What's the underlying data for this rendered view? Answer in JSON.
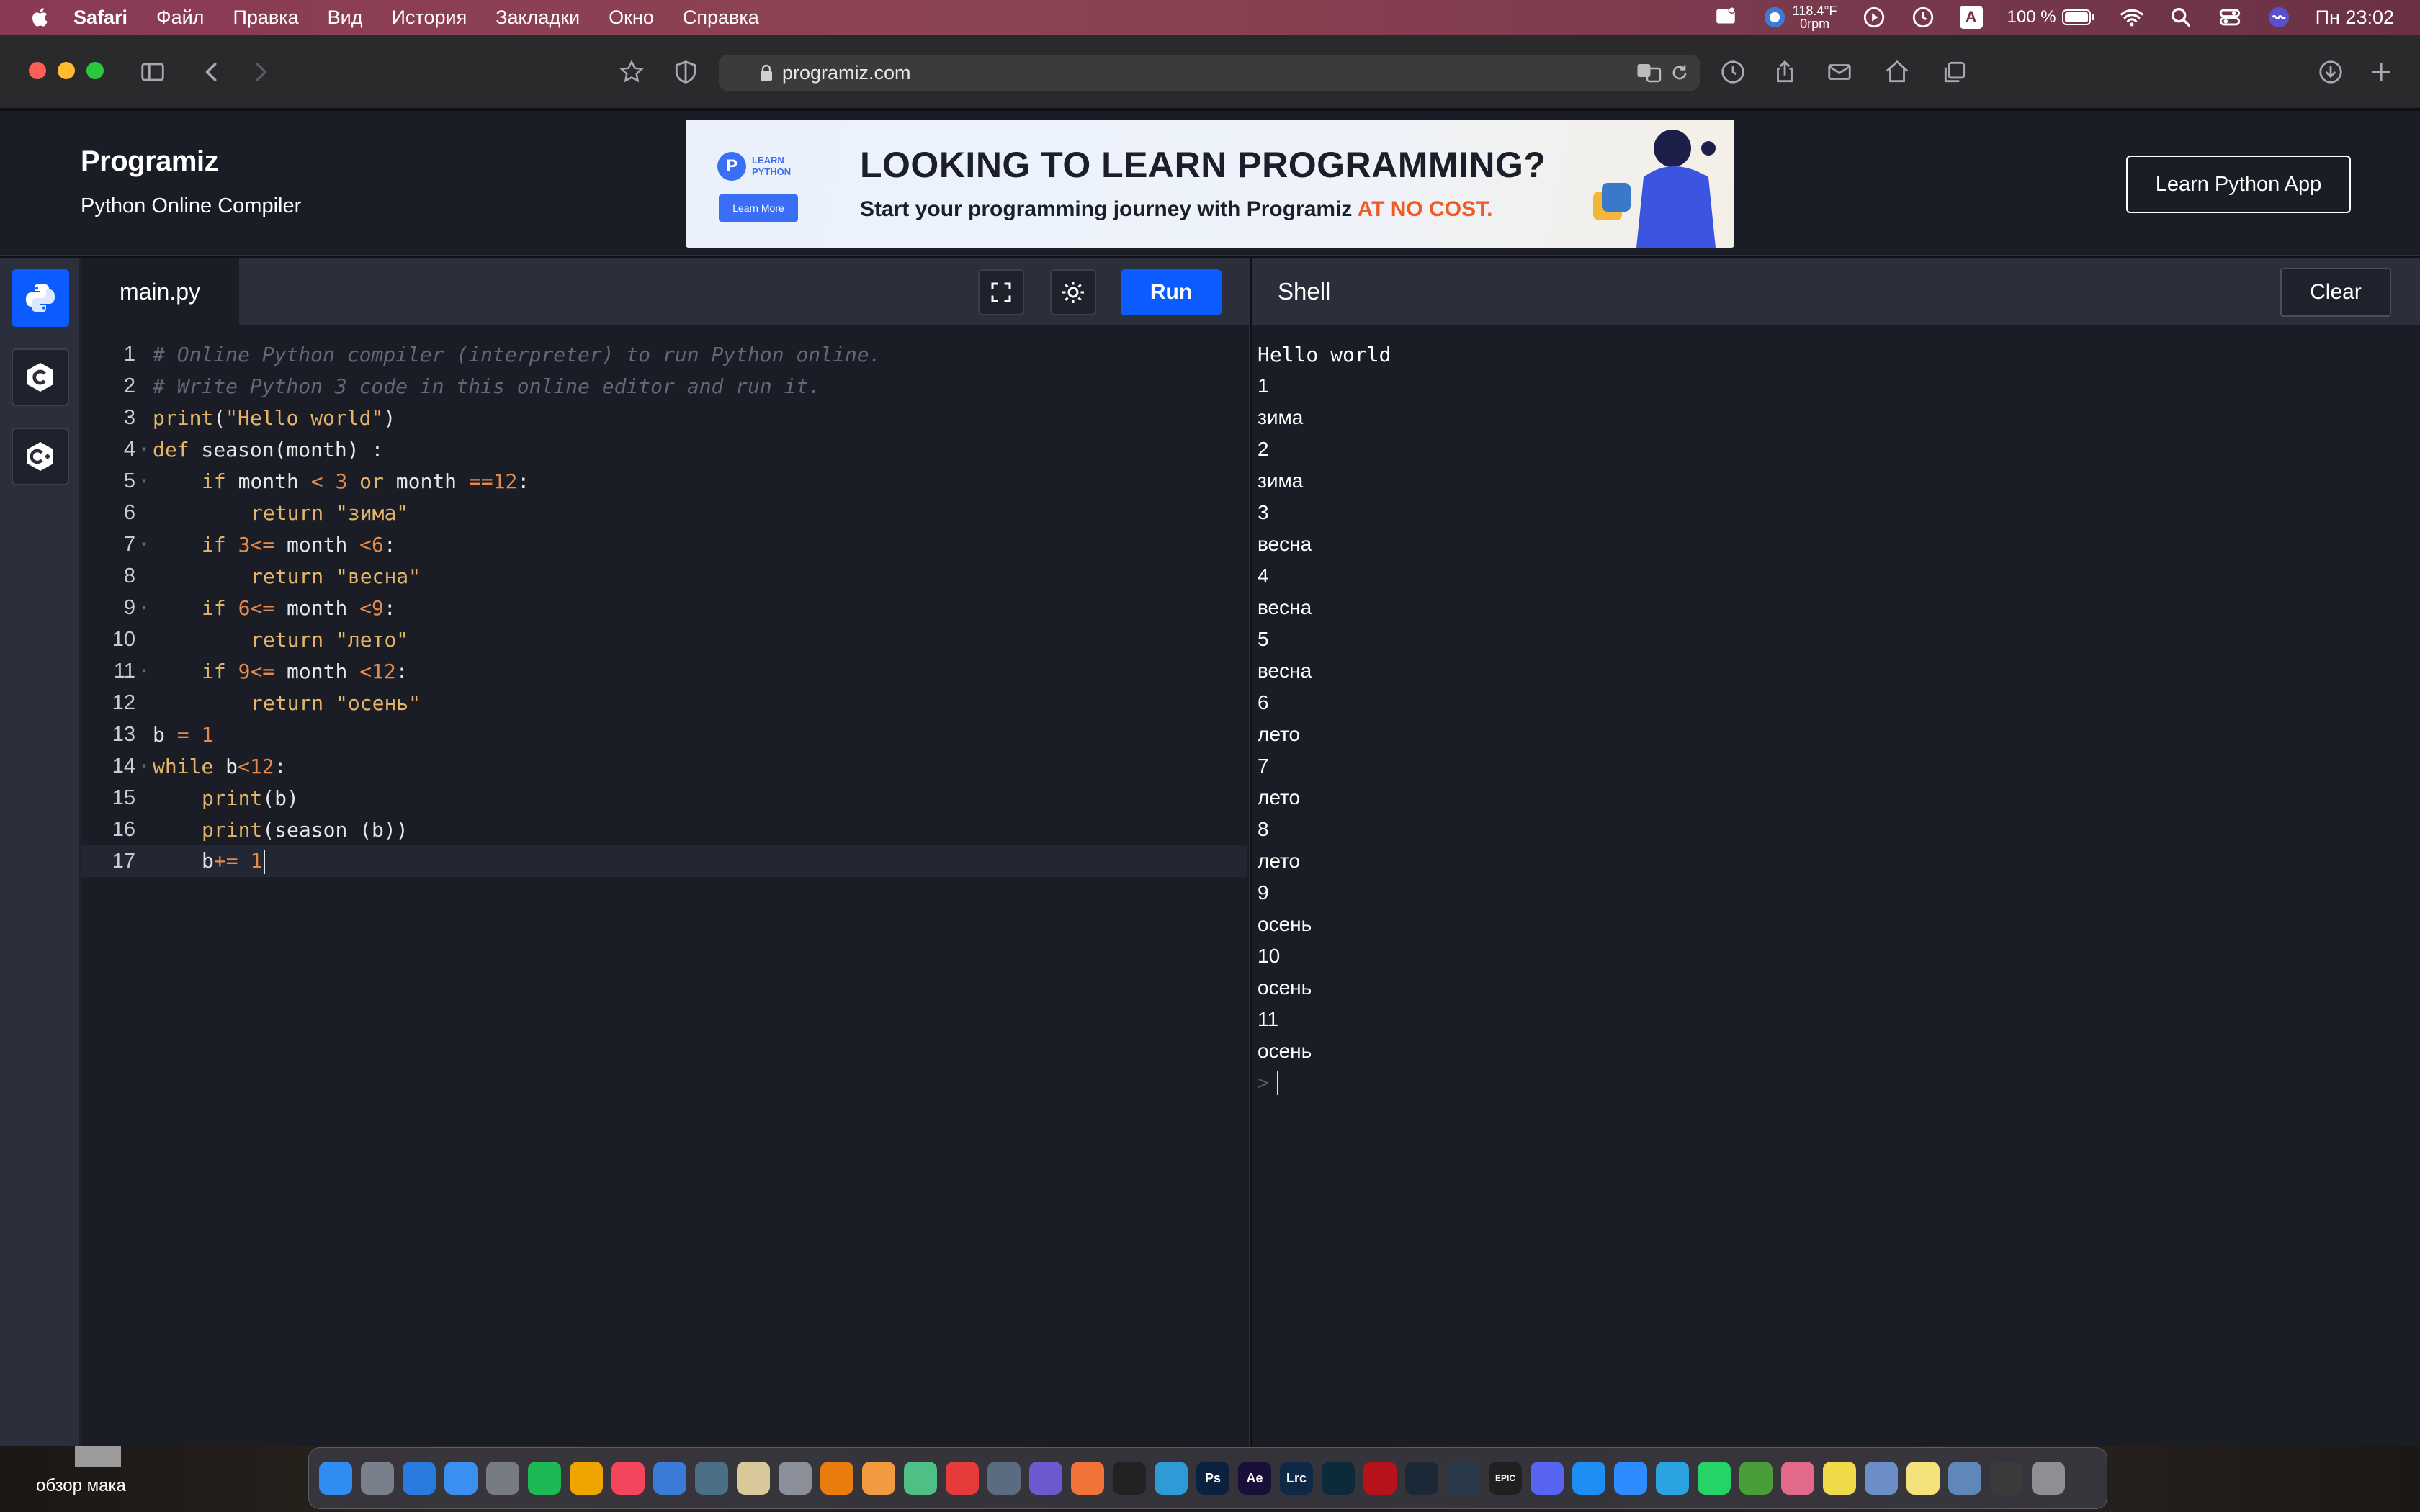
{
  "menubar": {
    "app": "Safari",
    "items": [
      "Файл",
      "Правка",
      "Вид",
      "История",
      "Закладки",
      "Окно",
      "Справка"
    ],
    "weather_temp": "118.4°F",
    "weather_rpm": "0rpm",
    "input_source": "A",
    "battery": "100 %",
    "clock": "Пн 23:02"
  },
  "browser": {
    "url": "programiz.com"
  },
  "site": {
    "logo": "Programiz",
    "subtitle": "Python Online Compiler",
    "learn_app_button": "Learn Python App",
    "banner": {
      "badge_line1": "LEARN",
      "badge_line2": "PYTHON",
      "badge_button": "Learn More",
      "headline": "LOOKING TO LEARN PROGRAMMING?",
      "sub_text": "Start your programming journey with Programiz ",
      "sub_highlight": "AT NO COST."
    }
  },
  "editor": {
    "file_tab": "main.py",
    "run_button": "Run",
    "lines": [
      {
        "n": "1",
        "fold": false,
        "indent": 0,
        "tokens": [
          [
            "cm",
            "# Online Python compiler (interpreter) to run Python online."
          ]
        ]
      },
      {
        "n": "2",
        "fold": false,
        "indent": 0,
        "tokens": [
          [
            "cm",
            "# Write Python 3 code in this online editor and run it."
          ]
        ]
      },
      {
        "n": "3",
        "fold": false,
        "indent": 0,
        "tokens": [
          [
            "fn",
            "print"
          ],
          [
            "pl",
            "("
          ],
          [
            "st",
            "\"Hello world\""
          ],
          [
            "pl",
            ")"
          ]
        ]
      },
      {
        "n": "4",
        "fold": true,
        "indent": 0,
        "tokens": [
          [
            "kw",
            "def"
          ],
          [
            "pl",
            " season(month) :"
          ]
        ]
      },
      {
        "n": "5",
        "fold": true,
        "indent": 1,
        "tokens": [
          [
            "kw",
            "if"
          ],
          [
            "pl",
            " month "
          ],
          [
            "op",
            "<"
          ],
          [
            "pl",
            " "
          ],
          [
            "nu",
            "3"
          ],
          [
            "pl",
            " "
          ],
          [
            "kw",
            "or"
          ],
          [
            "pl",
            " month "
          ],
          [
            "op",
            "=="
          ],
          [
            "nu",
            "12"
          ],
          [
            "pl",
            ":"
          ]
        ]
      },
      {
        "n": "6",
        "fold": false,
        "indent": 2,
        "tokens": [
          [
            "kw",
            "return"
          ],
          [
            "pl",
            " "
          ],
          [
            "st",
            "\"зима\""
          ]
        ]
      },
      {
        "n": "7",
        "fold": true,
        "indent": 1,
        "tokens": [
          [
            "kw",
            "if"
          ],
          [
            "pl",
            " "
          ],
          [
            "nu",
            "3"
          ],
          [
            "op",
            "<="
          ],
          [
            "pl",
            " month "
          ],
          [
            "op",
            "<"
          ],
          [
            "nu",
            "6"
          ],
          [
            "pl",
            ":"
          ]
        ]
      },
      {
        "n": "8",
        "fold": false,
        "indent": 2,
        "tokens": [
          [
            "kw",
            "return"
          ],
          [
            "pl",
            " "
          ],
          [
            "st",
            "\"весна\""
          ]
        ]
      },
      {
        "n": "9",
        "fold": true,
        "indent": 1,
        "tokens": [
          [
            "kw",
            "if"
          ],
          [
            "pl",
            " "
          ],
          [
            "nu",
            "6"
          ],
          [
            "op",
            "<="
          ],
          [
            "pl",
            " month "
          ],
          [
            "op",
            "<"
          ],
          [
            "nu",
            "9"
          ],
          [
            "pl",
            ":"
          ]
        ]
      },
      {
        "n": "10",
        "fold": false,
        "indent": 2,
        "tokens": [
          [
            "kw",
            "return"
          ],
          [
            "pl",
            " "
          ],
          [
            "st",
            "\"лето\""
          ]
        ]
      },
      {
        "n": "11",
        "fold": true,
        "indent": 1,
        "tokens": [
          [
            "kw",
            "if"
          ],
          [
            "pl",
            " "
          ],
          [
            "nu",
            "9"
          ],
          [
            "op",
            "<="
          ],
          [
            "pl",
            " month "
          ],
          [
            "op",
            "<"
          ],
          [
            "nu",
            "12"
          ],
          [
            "pl",
            ":"
          ]
        ]
      },
      {
        "n": "12",
        "fold": false,
        "indent": 2,
        "tokens": [
          [
            "kw",
            "return"
          ],
          [
            "pl",
            " "
          ],
          [
            "st",
            "\"осень\""
          ]
        ]
      },
      {
        "n": "13",
        "fold": false,
        "indent": 0,
        "tokens": [
          [
            "pl",
            "b "
          ],
          [
            "op",
            "="
          ],
          [
            "pl",
            " "
          ],
          [
            "nu",
            "1"
          ]
        ]
      },
      {
        "n": "14",
        "fold": true,
        "indent": 0,
        "tokens": [
          [
            "kw",
            "while"
          ],
          [
            "pl",
            " b"
          ],
          [
            "op",
            "<"
          ],
          [
            "nu",
            "12"
          ],
          [
            "pl",
            ":"
          ]
        ]
      },
      {
        "n": "15",
        "fold": false,
        "indent": 1,
        "tokens": [
          [
            "fn",
            "print"
          ],
          [
            "pl",
            "(b)"
          ]
        ]
      },
      {
        "n": "16",
        "fold": false,
        "indent": 1,
        "tokens": [
          [
            "fn",
            "print"
          ],
          [
            "pl",
            "(season (b))"
          ]
        ]
      },
      {
        "n": "17",
        "fold": false,
        "indent": 1,
        "active": true,
        "tokens": [
          [
            "pl",
            "b"
          ],
          [
            "op",
            "+="
          ],
          [
            "pl",
            " "
          ],
          [
            "nu",
            "1"
          ]
        ]
      }
    ]
  },
  "shell": {
    "title": "Shell",
    "clear_button": "Clear",
    "output": [
      "Hello world",
      "1",
      "зима",
      "2",
      "зима",
      "3",
      "весна",
      "4",
      "весна",
      "5",
      "весна",
      "6",
      "лето",
      "7",
      "лето",
      "8",
      "лето",
      "9",
      "осень",
      "10",
      "осень",
      "11",
      "осень"
    ],
    "prompt": ">"
  },
  "desktop": {
    "label": "обзор мака"
  },
  "dock": {
    "apps": [
      {
        "name": "finder",
        "color": "#2f8cf0",
        "glyph": ""
      },
      {
        "name": "launchpad",
        "color": "#7a7f8c",
        "glyph": ""
      },
      {
        "name": "safari",
        "color": "#2a7be0",
        "glyph": ""
      },
      {
        "name": "mail",
        "color": "#3a8ff0",
        "glyph": ""
      },
      {
        "name": "system-preferences",
        "color": "#777b84",
        "glyph": ""
      },
      {
        "name": "spotify",
        "color": "#1db954",
        "glyph": ""
      },
      {
        "name": "music-alt",
        "color": "#f0a400",
        "glyph": ""
      },
      {
        "name": "music",
        "color": "#f5455c",
        "glyph": ""
      },
      {
        "name": "xcode",
        "color": "#3b7bd8",
        "glyph": ""
      },
      {
        "name": "ledger",
        "color": "#4a6f86",
        "glyph": ""
      },
      {
        "name": "preview",
        "color": "#d9c89a",
        "glyph": ""
      },
      {
        "name": "pen-tool",
        "color": "#8b8f99",
        "glyph": ""
      },
      {
        "name": "blender",
        "color": "#e87d0d",
        "glyph": ""
      },
      {
        "name": "sublime",
        "color": "#f29a3f",
        "glyph": ""
      },
      {
        "name": "atom",
        "color": "#4fbf86",
        "glyph": ""
      },
      {
        "name": "infuse",
        "color": "#e63b3b",
        "glyph": ""
      },
      {
        "name": "davinci",
        "color": "#5b6b80",
        "glyph": ""
      },
      {
        "name": "final-cut",
        "color": "#6a5acd",
        "glyph": ""
      },
      {
        "name": "garageband",
        "color": "#f0733a",
        "glyph": ""
      },
      {
        "name": "figma",
        "color": "#222222",
        "glyph": ""
      },
      {
        "name": "sketch-stack",
        "color": "#2e9bd6",
        "glyph": ""
      },
      {
        "name": "photoshop",
        "color": "#0b2140",
        "glyph": "Ps"
      },
      {
        "name": "after-effects",
        "color": "#1a0f3a",
        "glyph": "Ae"
      },
      {
        "name": "lightroom",
        "color": "#0f2845",
        "glyph": "Lrc"
      },
      {
        "name": "league",
        "color": "#0c2a3a",
        "glyph": ""
      },
      {
        "name": "biohazard",
        "color": "#b5121b",
        "glyph": ""
      },
      {
        "name": "steam",
        "color": "#1b2838",
        "glyph": ""
      },
      {
        "name": "electron",
        "color": "#2b3a4a",
        "glyph": ""
      },
      {
        "name": "epic-games",
        "color": "#202020",
        "glyph": "EPIC"
      },
      {
        "name": "discord",
        "color": "#5865f2",
        "glyph": ""
      },
      {
        "name": "app-store",
        "color": "#1e8ef5",
        "glyph": ""
      },
      {
        "name": "zoom",
        "color": "#2d8cff",
        "glyph": ""
      },
      {
        "name": "telegram",
        "color": "#2aa3e0",
        "glyph": ""
      },
      {
        "name": "whatsapp",
        "color": "#25d366",
        "glyph": ""
      },
      {
        "name": "utorrent",
        "color": "#4a9e3a",
        "glyph": ""
      },
      {
        "name": "photos-alt",
        "color": "#e2698a",
        "glyph": ""
      },
      {
        "name": "stickies",
        "color": "#f2d94a",
        "glyph": ""
      },
      {
        "name": "preview-docs",
        "color": "#6a8ec5",
        "glyph": ""
      },
      {
        "name": "notes",
        "color": "#f5e27a",
        "glyph": ""
      },
      {
        "name": "screenshot",
        "color": "#5f87b8",
        "glyph": ""
      },
      {
        "name": "downloads-stack",
        "color": "#3a3a3a",
        "glyph": ""
      },
      {
        "name": "trash",
        "color": "#8d8f94",
        "glyph": ""
      }
    ]
  }
}
